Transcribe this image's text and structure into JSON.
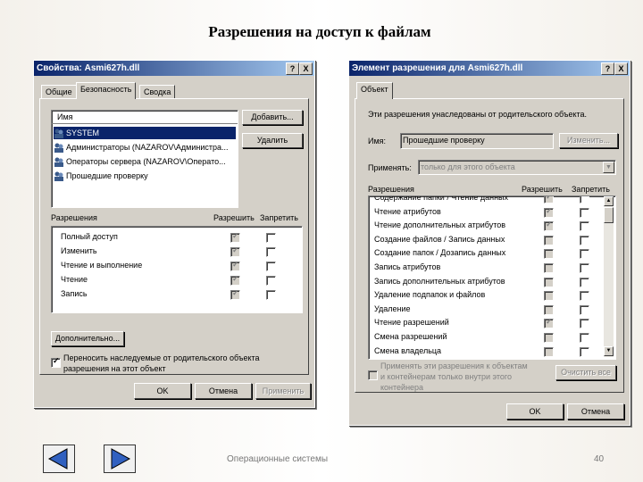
{
  "slide": {
    "title": "Разрешения на доступ к  файлам",
    "footer_text": "Операционные системы",
    "page_number": "40"
  },
  "dialog1": {
    "title": "Свойства: Asmi627h.dll",
    "help": "?",
    "close": "X",
    "tabs": [
      "Общие",
      "Безопасность",
      "Сводка"
    ],
    "name_header": "Имя",
    "users": [
      "SYSTEM",
      "Администраторы (NAZAROV\\Администра...",
      "Операторы сервера (NAZAROV\\Операто...",
      "Прошедшие проверку"
    ],
    "add_button": "Добавить...",
    "remove_button": "Удалить",
    "perm_header": "Разрешения",
    "allow_header": "Разрешить",
    "deny_header": "Запретить",
    "permissions": [
      "Полный доступ",
      "Изменить",
      "Чтение и выполнение",
      "Чтение",
      "Запись"
    ],
    "advanced_button": "Дополнительно...",
    "inherit_text_1": "Переносить наследуемые от родительского объекта",
    "inherit_text_2": "разрешения на этот объект",
    "ok": "OK",
    "cancel": "Отмена",
    "apply": "Применить"
  },
  "dialog2": {
    "title": "Элемент разрешения для Asmi627h.dll",
    "help": "?",
    "close": "X",
    "tab": "Объект",
    "inherited_note": "Эти разрешения унаследованы от родительского объекта.",
    "name_label": "Имя:",
    "name_value": "Прошедшие проверку",
    "change_button": "Изменить...",
    "apply_to_label": "Применять:",
    "apply_to_value": "только для этого объекта",
    "perm_header": "Разрешения",
    "allow_header": "Разрешить",
    "deny_header": "Запретить",
    "permissions": [
      "Содержание папки / Чтение данных",
      "Чтение атрибутов",
      "Чтение дополнительных атрибутов",
      "Создание файлов / Запись данных",
      "Создание папок / Дозапись данных",
      "Запись атрибутов",
      "Запись дополнительных атрибутов",
      "Удаление подпапок и файлов",
      "Удаление",
      "Чтение разрешений",
      "Смена разрешений",
      "Смена владельца"
    ],
    "apply_children_1": "Применять эти разрешения к объектам",
    "apply_children_2": "и контейнерам только внутри этого",
    "apply_children_3": "контейнера",
    "clear_all_button": "Очистить все",
    "ok": "OK",
    "cancel": "Отмена"
  }
}
